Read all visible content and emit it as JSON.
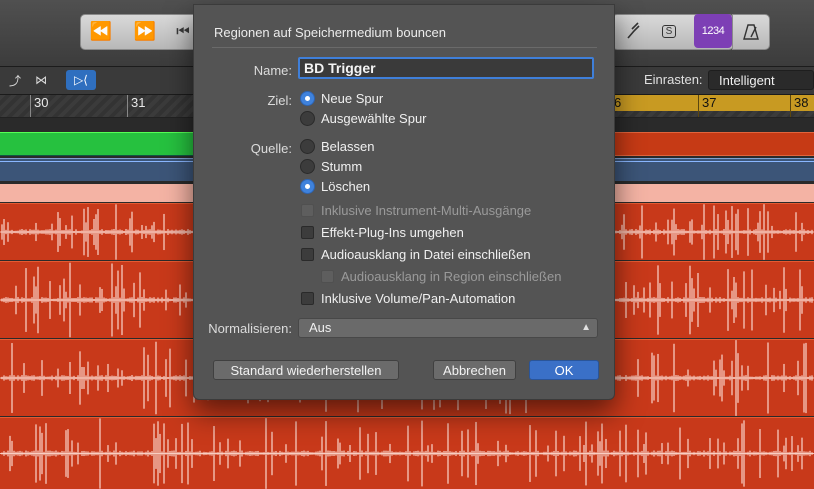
{
  "toolbar": {
    "rewind_icon": "rewind-icon",
    "forward_icon": "fast-forward-icon",
    "count_in_label": "1234"
  },
  "subbar": {
    "snap_label": "Einrasten:",
    "snap_value": "Intelligent"
  },
  "ruler": {
    "marks_left": [
      "30",
      "31"
    ],
    "marks_right": [
      "6",
      "37",
      "38"
    ]
  },
  "dialog": {
    "title": "Regionen auf Speichermedium bouncen",
    "name_label": "Name:",
    "name_value": "BD Trigger",
    "ziel_label": "Ziel:",
    "ziel_options": [
      {
        "label": "Neue Spur",
        "selected": true
      },
      {
        "label": "Ausgewählte Spur",
        "selected": false
      }
    ],
    "quelle_label": "Quelle:",
    "quelle_options": [
      {
        "label": "Belassen",
        "selected": false
      },
      {
        "label": "Stumm",
        "selected": false
      },
      {
        "label": "Löschen",
        "selected": true
      }
    ],
    "checkboxes": [
      {
        "label": "Inklusive Instrument-Multi-Ausgänge",
        "checked": false,
        "enabled": false
      },
      {
        "label": "Effekt-Plug-Ins umgehen",
        "checked": false,
        "enabled": true
      },
      {
        "label": "Audioausklang in Datei einschließen",
        "checked": false,
        "enabled": true
      },
      {
        "label": "Audioausklang in Region einschließen",
        "checked": false,
        "enabled": false
      },
      {
        "label": "Inklusive Volume/Pan-Automation",
        "checked": false,
        "enabled": true
      }
    ],
    "normalize_label": "Normalisieren:",
    "normalize_value": "Aus",
    "btn_restore": "Standard wiederherstellen",
    "btn_cancel": "Abbrechen",
    "btn_ok": "OK"
  },
  "colors": {
    "accent": "#3f82dc",
    "audio_region": "#c8391a",
    "green_region": "#26c13f",
    "cycle": "#c89a22",
    "count_in": "#7d3fb5"
  }
}
